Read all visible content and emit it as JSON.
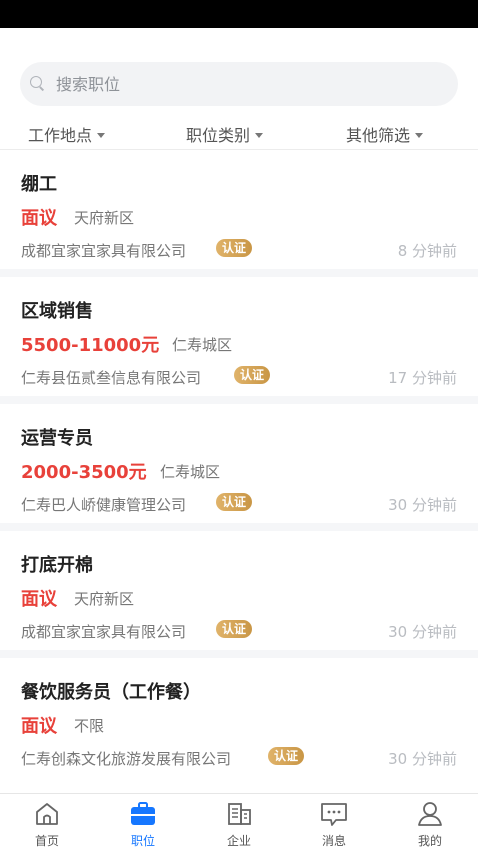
{
  "search": {
    "placeholder": "搜索职位"
  },
  "filters": [
    {
      "label": "工作地点"
    },
    {
      "label": "职位类别"
    },
    {
      "label": "其他筛选"
    }
  ],
  "jobs": [
    {
      "title": "绷工",
      "salary": "面议",
      "location": "天府新区",
      "company": "成都宜家宜家具有限公司",
      "badge": "认证",
      "time": "8 分钟前"
    },
    {
      "title": "区域销售",
      "salary": "5500-11000元",
      "location": "仁寿城区",
      "company": "仁寿县伍贰叁信息有限公司",
      "badge": "认证",
      "time": "17 分钟前"
    },
    {
      "title": "运营专员",
      "salary": "2000-3500元",
      "location": "仁寿城区",
      "company": "仁寿巴人峤健康管理公司",
      "badge": "认证",
      "time": "30 分钟前"
    },
    {
      "title": "打底开棉",
      "salary": "面议",
      "location": "天府新区",
      "company": "成都宜家宜家具有限公司",
      "badge": "认证",
      "time": "30 分钟前"
    },
    {
      "title": "餐饮服务员（工作餐）",
      "salary": "面议",
      "location": "不限",
      "company": "仁寿创森文化旅游发展有限公司",
      "badge": "认证",
      "time": "30 分钟前"
    }
  ],
  "tabs": [
    {
      "label": "首页",
      "icon": "home-icon"
    },
    {
      "label": "职位",
      "icon": "briefcase-icon",
      "active": true
    },
    {
      "label": "企业",
      "icon": "building-icon"
    },
    {
      "label": "消息",
      "icon": "message-icon"
    },
    {
      "label": "我的",
      "icon": "profile-icon"
    }
  ],
  "colors": {
    "accent": "#1677ff",
    "salary": "#e8413a",
    "badge": "#d4a45a"
  }
}
